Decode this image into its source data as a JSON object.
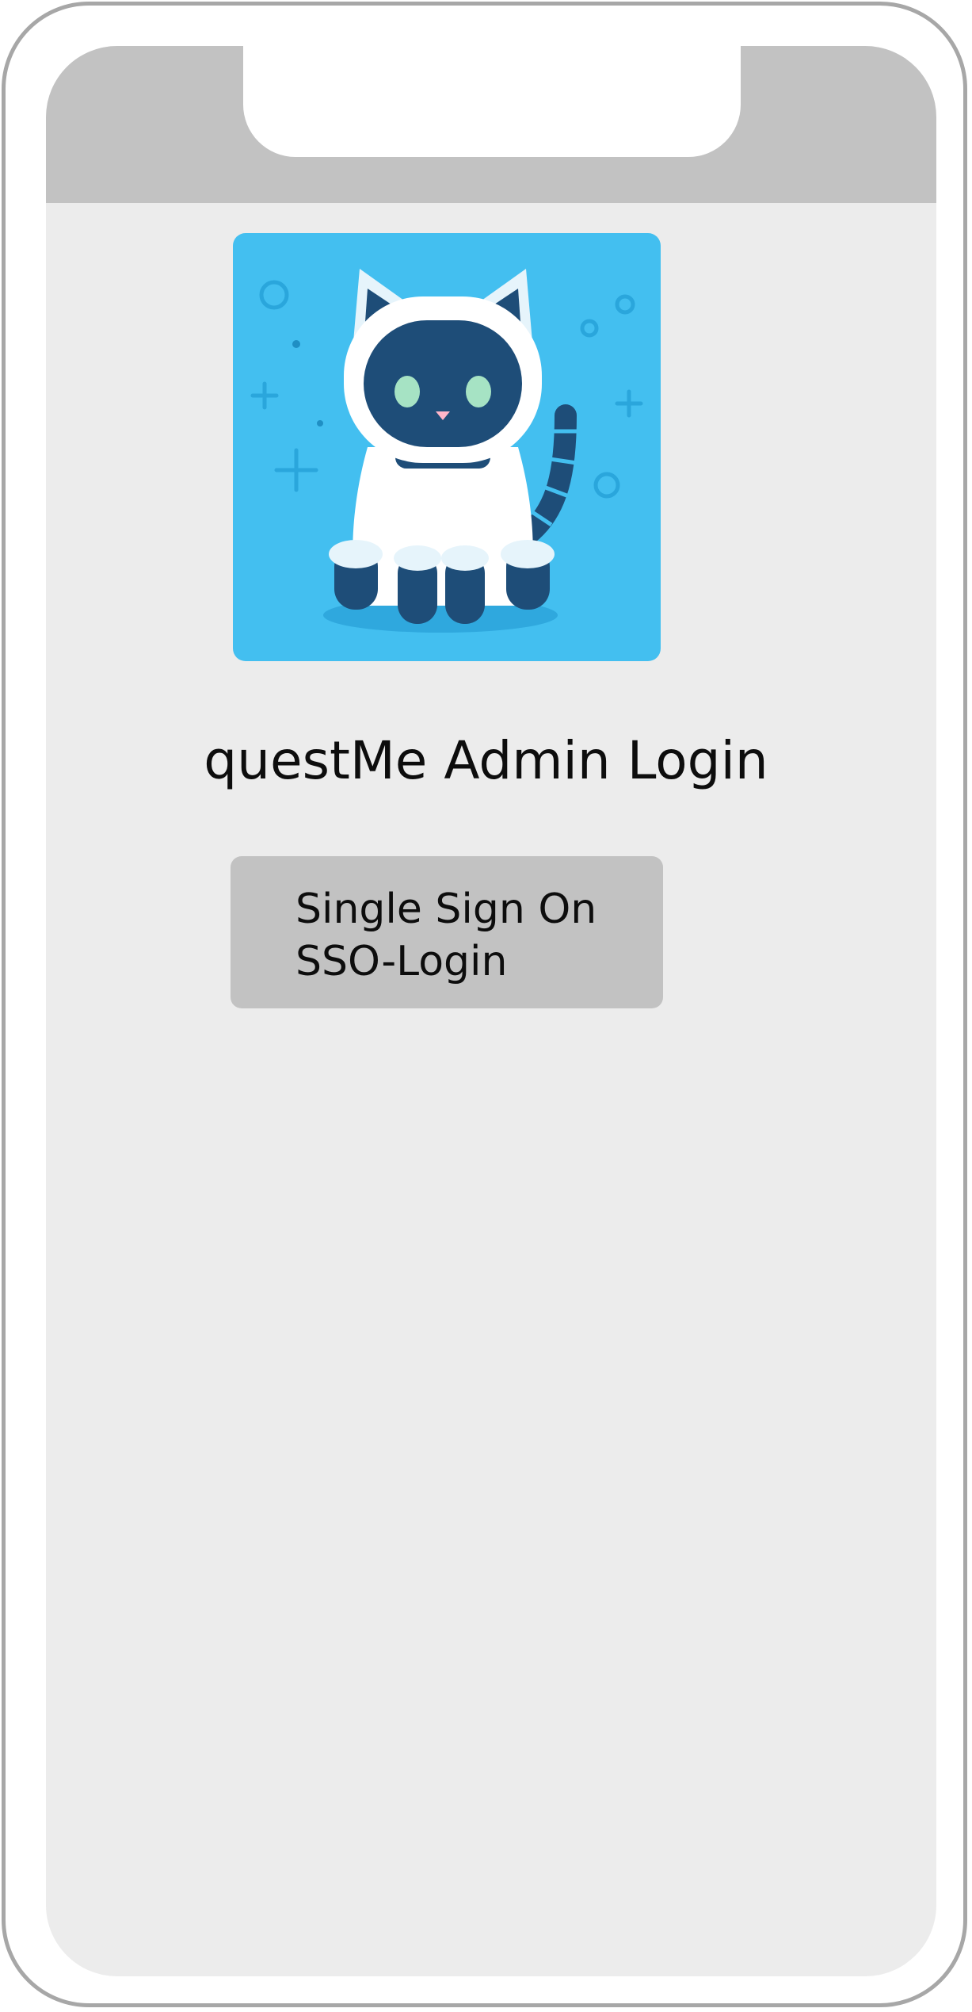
{
  "app": {
    "title": "questMe Admin Login",
    "logo_icon": "robot-cat-icon"
  },
  "login": {
    "sso_line1": "Single Sign On",
    "sso_line2": "SSO-Login"
  },
  "colors": {
    "screen_background": "#ececec",
    "status_bar": "#c2c2c2",
    "button_background": "#c2c2c2",
    "logo_background": "#43bff0",
    "logo_dark": "#1e4d78"
  }
}
